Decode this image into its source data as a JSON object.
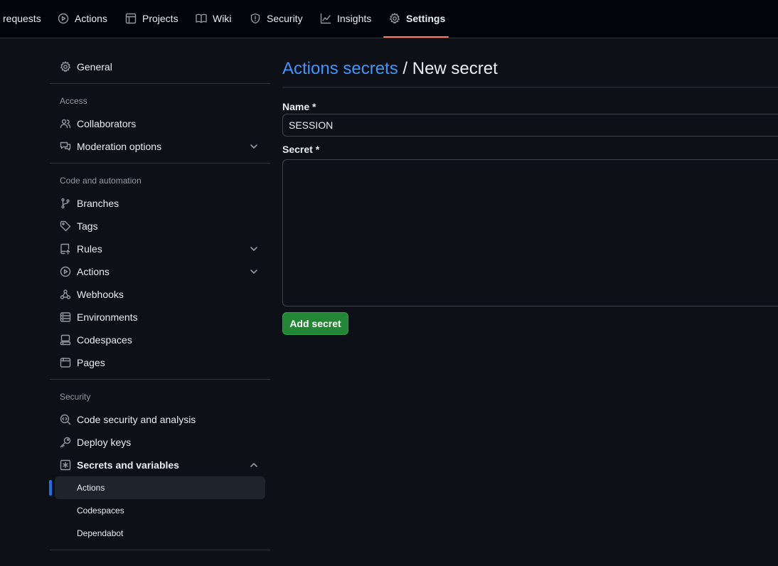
{
  "topnav": {
    "tabs": [
      {
        "label": "requests",
        "icon": "pull-request-icon"
      },
      {
        "label": "Actions",
        "icon": "play-icon"
      },
      {
        "label": "Projects",
        "icon": "table-icon"
      },
      {
        "label": "Wiki",
        "icon": "book-icon"
      },
      {
        "label": "Security",
        "icon": "shield-icon"
      },
      {
        "label": "Insights",
        "icon": "graph-icon"
      },
      {
        "label": "Settings",
        "icon": "gear-icon",
        "active": true
      }
    ]
  },
  "sidebar": {
    "general": "General",
    "access": {
      "label": "Access",
      "items": [
        "Collaborators",
        "Moderation options"
      ]
    },
    "code": {
      "label": "Code and automation",
      "items": [
        "Branches",
        "Tags",
        "Rules",
        "Actions",
        "Webhooks",
        "Environments",
        "Codespaces",
        "Pages"
      ]
    },
    "security": {
      "label": "Security",
      "items": [
        "Code security and analysis",
        "Deploy keys",
        "Secrets and variables"
      ],
      "sub_items": [
        "Actions",
        "Codespaces",
        "Dependabot"
      ]
    }
  },
  "main": {
    "breadcrumb_link": "Actions secrets",
    "breadcrumb_sep": " / ",
    "title": "New secret",
    "name_label": "Name *",
    "name_value": "SESSION",
    "secret_label": "Secret *",
    "secret_value": "",
    "add_button": "Add secret"
  },
  "colors": {
    "accent_link": "#4493f8",
    "button_green": "#238636",
    "active_tab_underline": "#f78166"
  }
}
